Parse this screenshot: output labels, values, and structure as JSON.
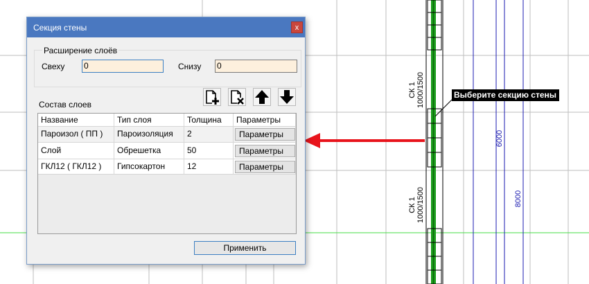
{
  "dialog": {
    "title": "Секция стены",
    "close_glyph": "x",
    "extension_group": {
      "legend": "Расширение слоёв",
      "top_label": "Свеху",
      "top_value": "0",
      "bottom_label": "Снизу",
      "bottom_value": "0"
    },
    "layers_label": "Состав слоев",
    "toolbar": [
      "add-layer-icon",
      "delete-layer-icon",
      "arrow-up-icon",
      "arrow-down-icon"
    ],
    "table": {
      "columns": [
        "Название",
        "Тип слоя",
        "Толщина",
        "Параметры"
      ],
      "rows": [
        {
          "name": "Пароизол ( ПП )",
          "type": "Пароизоляция",
          "thickness": "2",
          "params": "Параметры"
        },
        {
          "name": "Слой",
          "type": "Обрешетка",
          "thickness": "50",
          "params": "Параметры"
        },
        {
          "name": "ГКЛ12 ( ГКЛ12 )",
          "type": "Гипсокартон",
          "thickness": "12",
          "params": "Параметры"
        }
      ]
    },
    "apply_label": "Применить"
  },
  "canvas": {
    "hint": "Выберите секцию стены",
    "wall_labels": [
      {
        "line1": "СК 1",
        "line2": "1000/1500"
      },
      {
        "line1": "СК 1",
        "line2": "1000/1500"
      }
    ],
    "dimensions": [
      "6000",
      "8000"
    ],
    "colors": {
      "wall_green": "#1a9a1a",
      "grid_green": "#44dd44",
      "dimension_blue": "#1b1bb0",
      "arrow_red": "#e8141c"
    }
  }
}
